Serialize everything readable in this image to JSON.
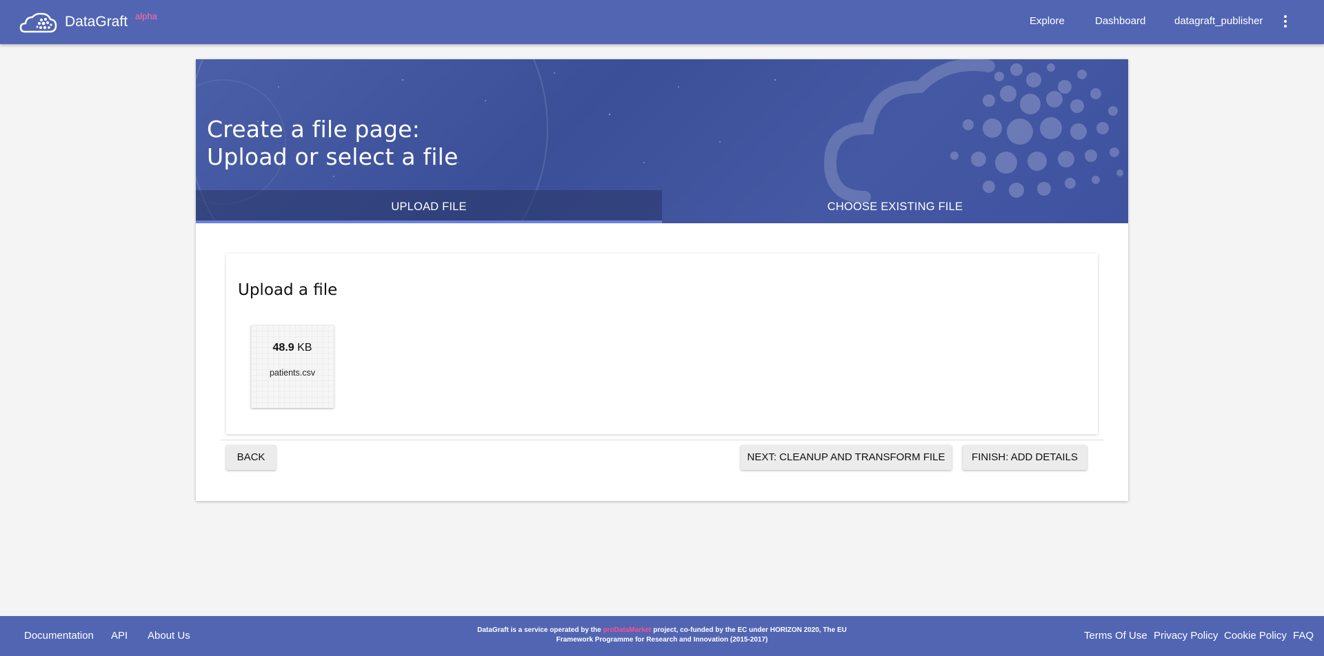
{
  "header": {
    "brand": "DataGraft",
    "brand_sup": "alpha",
    "nav": {
      "explore": "Explore",
      "dashboard": "Dashboard",
      "user": "datagraft_publisher"
    }
  },
  "hero": {
    "title_line1": "Create a file page:",
    "title_line2": "Upload or select a file",
    "tabs": {
      "upload": "UPLOAD FILE",
      "existing": "CHOOSE EXISTING FILE"
    }
  },
  "upload": {
    "heading": "Upload a file",
    "file": {
      "size_value": "48.9",
      "size_unit": "KB",
      "name": "patients.csv"
    }
  },
  "actions": {
    "back": "BACK",
    "next": "NEXT: CLEANUP AND TRANSFORM FILE",
    "finish": "FINISH: ADD DETAILS"
  },
  "footer": {
    "links_left": {
      "documentation": "Documentation",
      "api": "API",
      "about": "About Us"
    },
    "notice_pre": "DataGraft is a service operated by the",
    "notice_project": "proDataMarket",
    "notice_post": "project, co-funded by the EC under HORIZON 2020, The EU",
    "notice_line2": "Framework Programme for Research and Innovation (2015-2017)",
    "links_right": {
      "terms": "Terms Of Use",
      "privacy": "Privacy Policy",
      "cookie": "Cookie Policy",
      "faq": "FAQ"
    }
  },
  "colors": {
    "nav_bg": "#5265b3",
    "accent_pink": "#ff6fa3",
    "tab_indicator": "#6a7fe0"
  }
}
